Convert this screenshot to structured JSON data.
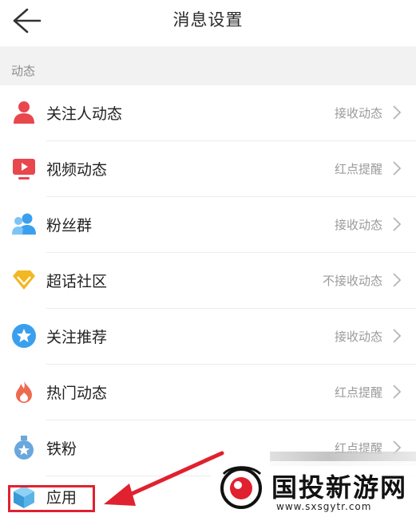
{
  "header": {
    "title": "消息设置",
    "back_icon": "arrow-left-icon"
  },
  "section": {
    "label": "动态"
  },
  "items": [
    {
      "label": "关注人动态",
      "value": "接收动态",
      "icon": "person-icon",
      "color": "#e8474d"
    },
    {
      "label": "视频动态",
      "value": "红点提醒",
      "icon": "video-play-icon",
      "color": "#e8474d"
    },
    {
      "label": "粉丝群",
      "value": "接收动态",
      "icon": "group-icon",
      "color": "#3aa0ee"
    },
    {
      "label": "超话社区",
      "value": "不接收动态",
      "icon": "diamond-icon",
      "color": "#f2b824"
    },
    {
      "label": "关注推荐",
      "value": "接收动态",
      "icon": "star-badge-icon",
      "color": "#3aa0ee"
    },
    {
      "label": "热门动态",
      "value": "红点提醒",
      "icon": "flame-icon",
      "color": "#ee6a4f"
    },
    {
      "label": "铁粉",
      "value": "红点提醒",
      "icon": "medal-icon",
      "color": "#6aa7dc"
    },
    {
      "label": "应用",
      "value": "",
      "icon": "cube-icon",
      "color": "#5ab3e8"
    }
  ],
  "annotation": {
    "highlight_color": "#e0212f"
  },
  "watermark": {
    "name": "国投新游网",
    "url": "www.sxsgytr.com"
  }
}
